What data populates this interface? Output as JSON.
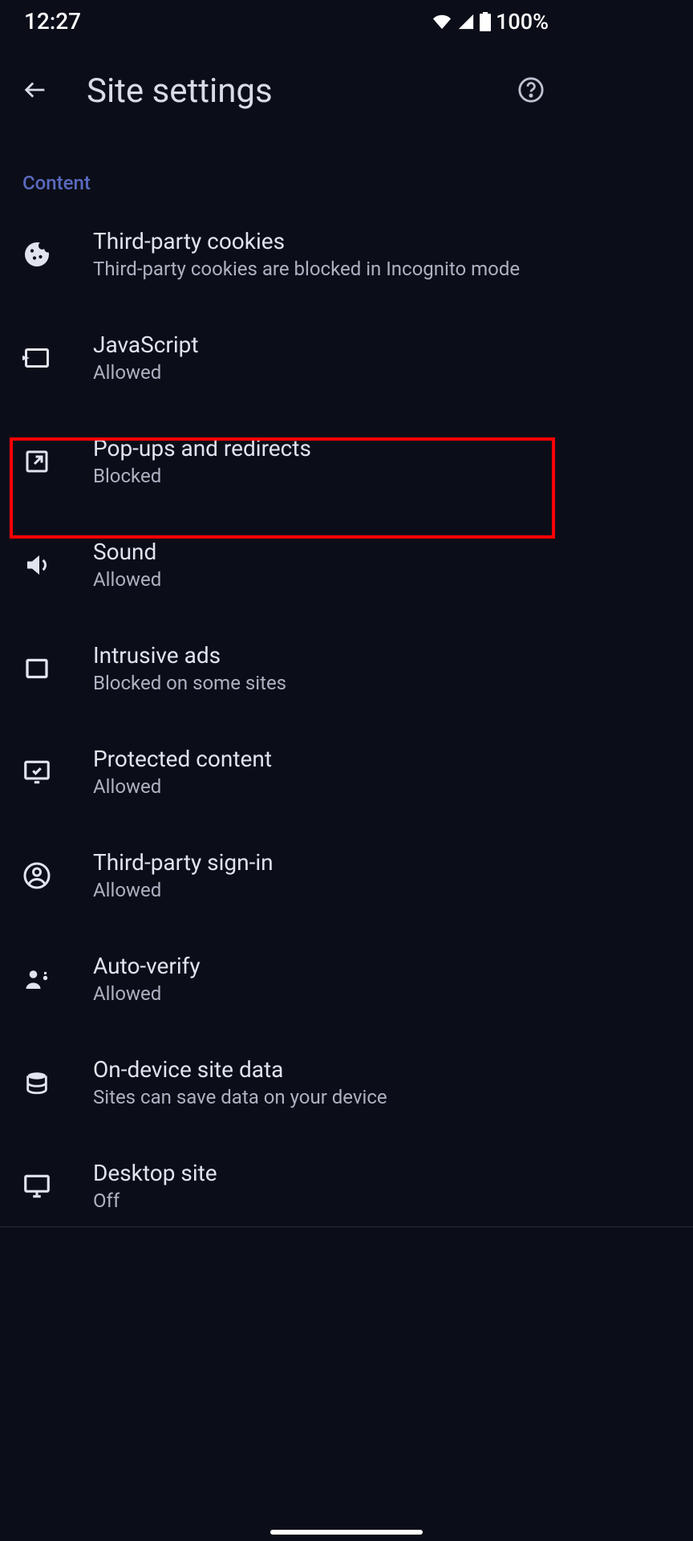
{
  "status": {
    "time": "12:27",
    "battery": "100%"
  },
  "header": {
    "title": "Site settings"
  },
  "section": {
    "label": "Content"
  },
  "items": [
    {
      "title": "Third-party cookies",
      "subtitle": "Third-party cookies are blocked in Incognito mode"
    },
    {
      "title": "JavaScript",
      "subtitle": "Allowed"
    },
    {
      "title": "Pop-ups and redirects",
      "subtitle": "Blocked"
    },
    {
      "title": "Sound",
      "subtitle": "Allowed"
    },
    {
      "title": "Intrusive ads",
      "subtitle": "Blocked on some sites"
    },
    {
      "title": "Protected content",
      "subtitle": "Allowed"
    },
    {
      "title": "Third-party sign-in",
      "subtitle": "Allowed"
    },
    {
      "title": "Auto-verify",
      "subtitle": "Allowed"
    },
    {
      "title": "On-device site data",
      "subtitle": "Sites can save data on your device"
    },
    {
      "title": "Desktop site",
      "subtitle": "Off"
    }
  ],
  "highlight": {
    "index": 2
  }
}
